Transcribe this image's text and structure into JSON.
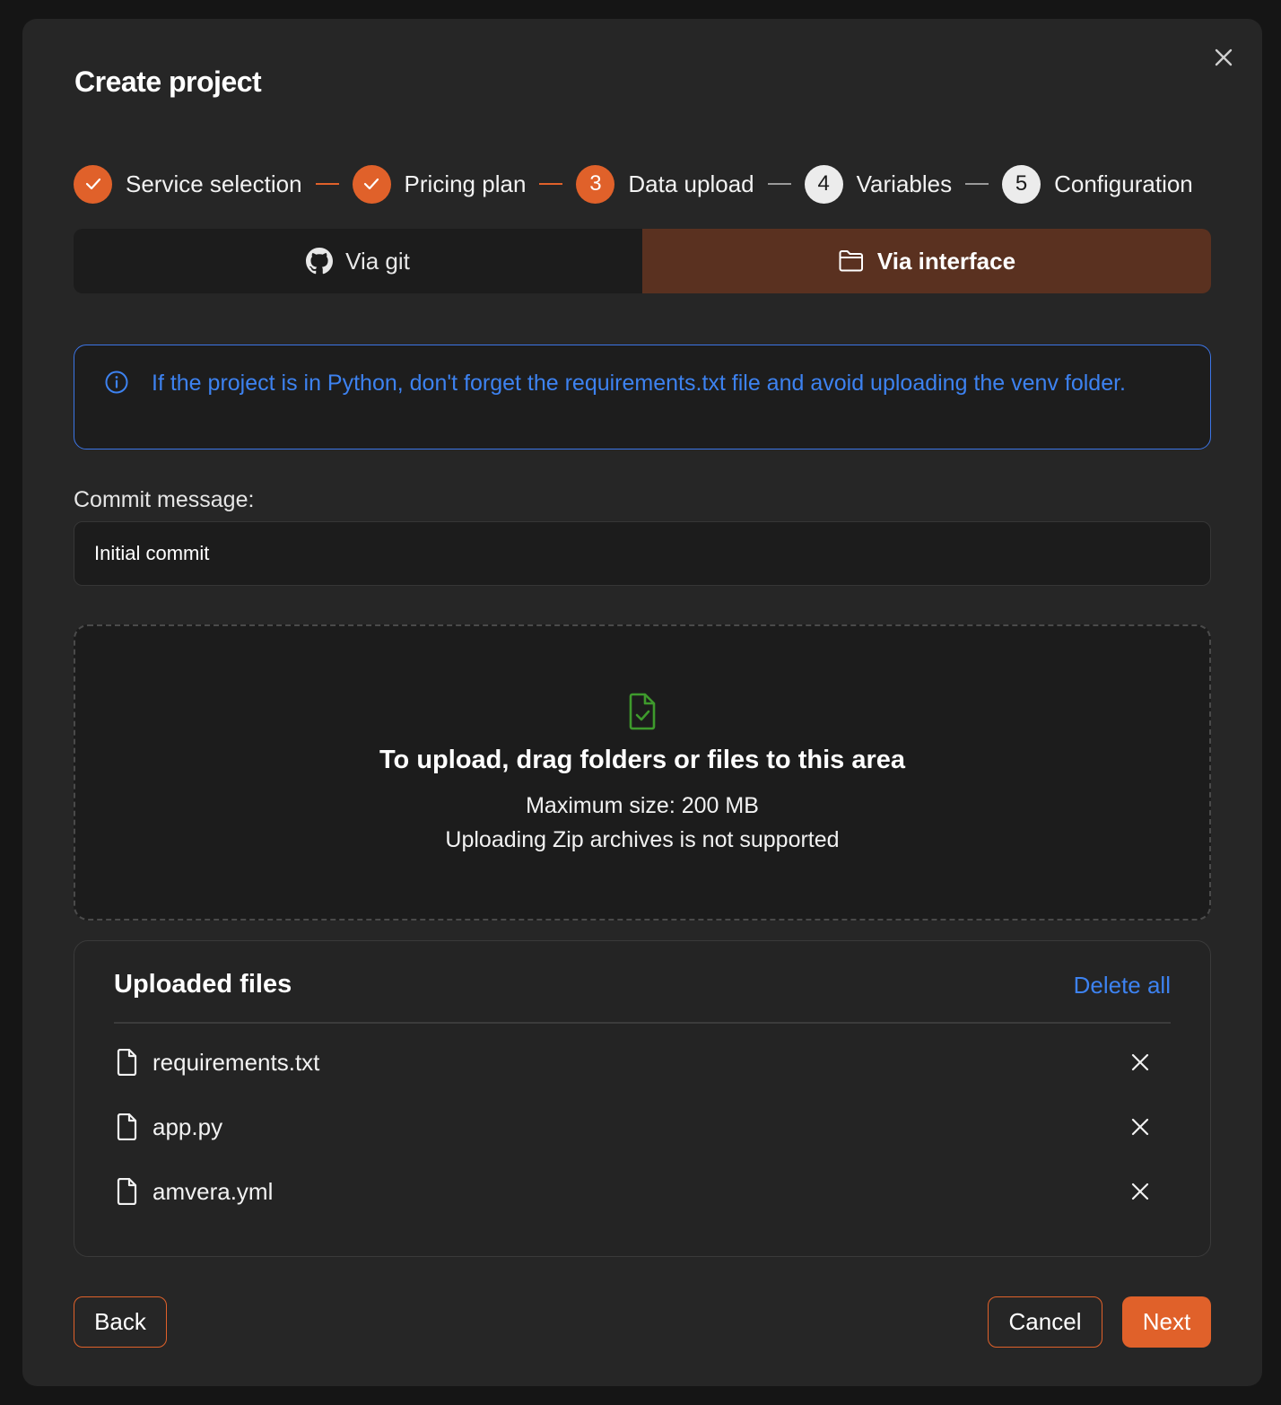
{
  "modal": {
    "title": "Create project"
  },
  "stepper": {
    "steps": [
      {
        "label": "Service selection",
        "state": "done",
        "marker": ""
      },
      {
        "label": "Pricing plan",
        "state": "done",
        "marker": ""
      },
      {
        "label": "Data upload",
        "state": "active",
        "marker": "3"
      },
      {
        "label": "Variables",
        "state": "todo",
        "marker": "4"
      },
      {
        "label": "Configuration",
        "state": "todo",
        "marker": "5"
      }
    ]
  },
  "tabs": {
    "git_label": "Via git",
    "interface_label": "Via interface",
    "active": "interface"
  },
  "alert": {
    "text": "If the project is in Python, don't forget the requirements.txt file and avoid uploading the venv folder."
  },
  "commit": {
    "label": "Commit message:",
    "value": "Initial commit"
  },
  "dropzone": {
    "title": "To upload, drag folders or files to this area",
    "max_size": "Maximum size: 200 MB",
    "zip_note": "Uploading Zip archives is not supported"
  },
  "uploaded": {
    "title": "Uploaded files",
    "delete_all": "Delete all",
    "files": [
      {
        "name": "requirements.txt"
      },
      {
        "name": "app.py"
      },
      {
        "name": "amvera.yml"
      }
    ]
  },
  "footer": {
    "back_label": "Back",
    "cancel_label": "Cancel",
    "next_label": "Next"
  },
  "colors": {
    "accent": "#e0612a",
    "info": "#3d82f0",
    "tab_active": "#5a3120",
    "success_icon": "#3e9a2c"
  }
}
